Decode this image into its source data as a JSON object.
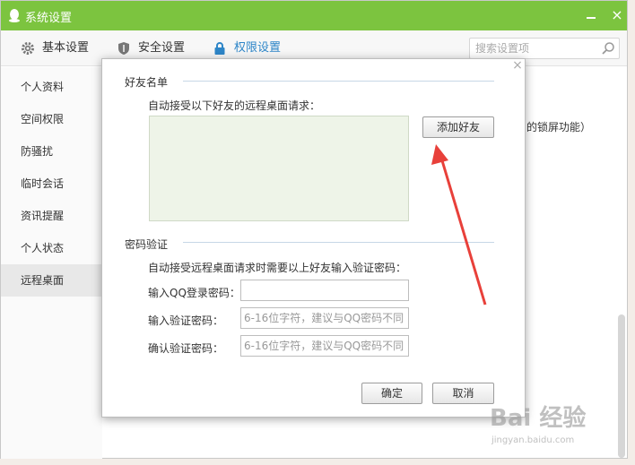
{
  "window": {
    "title": "系统设置",
    "accent_color": "#7cc43f",
    "close_glyph": "×"
  },
  "toolbar": {
    "tabs": [
      {
        "label": "基本设置",
        "icon": "gear-icon"
      },
      {
        "label": "安全设置",
        "icon": "shield-icon"
      },
      {
        "label": "权限设置",
        "icon": "lock-icon",
        "active": true
      }
    ],
    "search_placeholder": "搜索设置项"
  },
  "sidebar": {
    "items": [
      {
        "label": "个人资料"
      },
      {
        "label": "空间权限"
      },
      {
        "label": "防骚扰"
      },
      {
        "label": "临时会话"
      },
      {
        "label": "资讯提醒"
      },
      {
        "label": "个人状态"
      },
      {
        "label": "远程桌面",
        "active": true
      }
    ]
  },
  "background_text": "的锁屏功能）",
  "dialog": {
    "close_glyph": "×",
    "friends_section": {
      "title": "好友名单",
      "description": "自动接受以下好友的远程桌面请求：",
      "add_button": "添加好友"
    },
    "password_section": {
      "title": "密码验证",
      "description": "自动接受远程桌面请求时需要以上好友输入验证密码：",
      "fields": [
        {
          "label": "输入QQ登录密码：",
          "value": "",
          "placeholder": ""
        },
        {
          "label": "输入验证密码：",
          "value": "",
          "placeholder": "6-16位字符，建议与QQ密码不同"
        },
        {
          "label": "确认验证密码：",
          "value": "",
          "placeholder": "6-16位字符，建议与QQ密码不同"
        }
      ]
    },
    "ok_button": "确定",
    "cancel_button": "取消"
  },
  "annotation": {
    "arrow_color": "#e8403a"
  },
  "watermark": {
    "brand": "Bai 经验",
    "url": "jingyan.baidu.com"
  }
}
